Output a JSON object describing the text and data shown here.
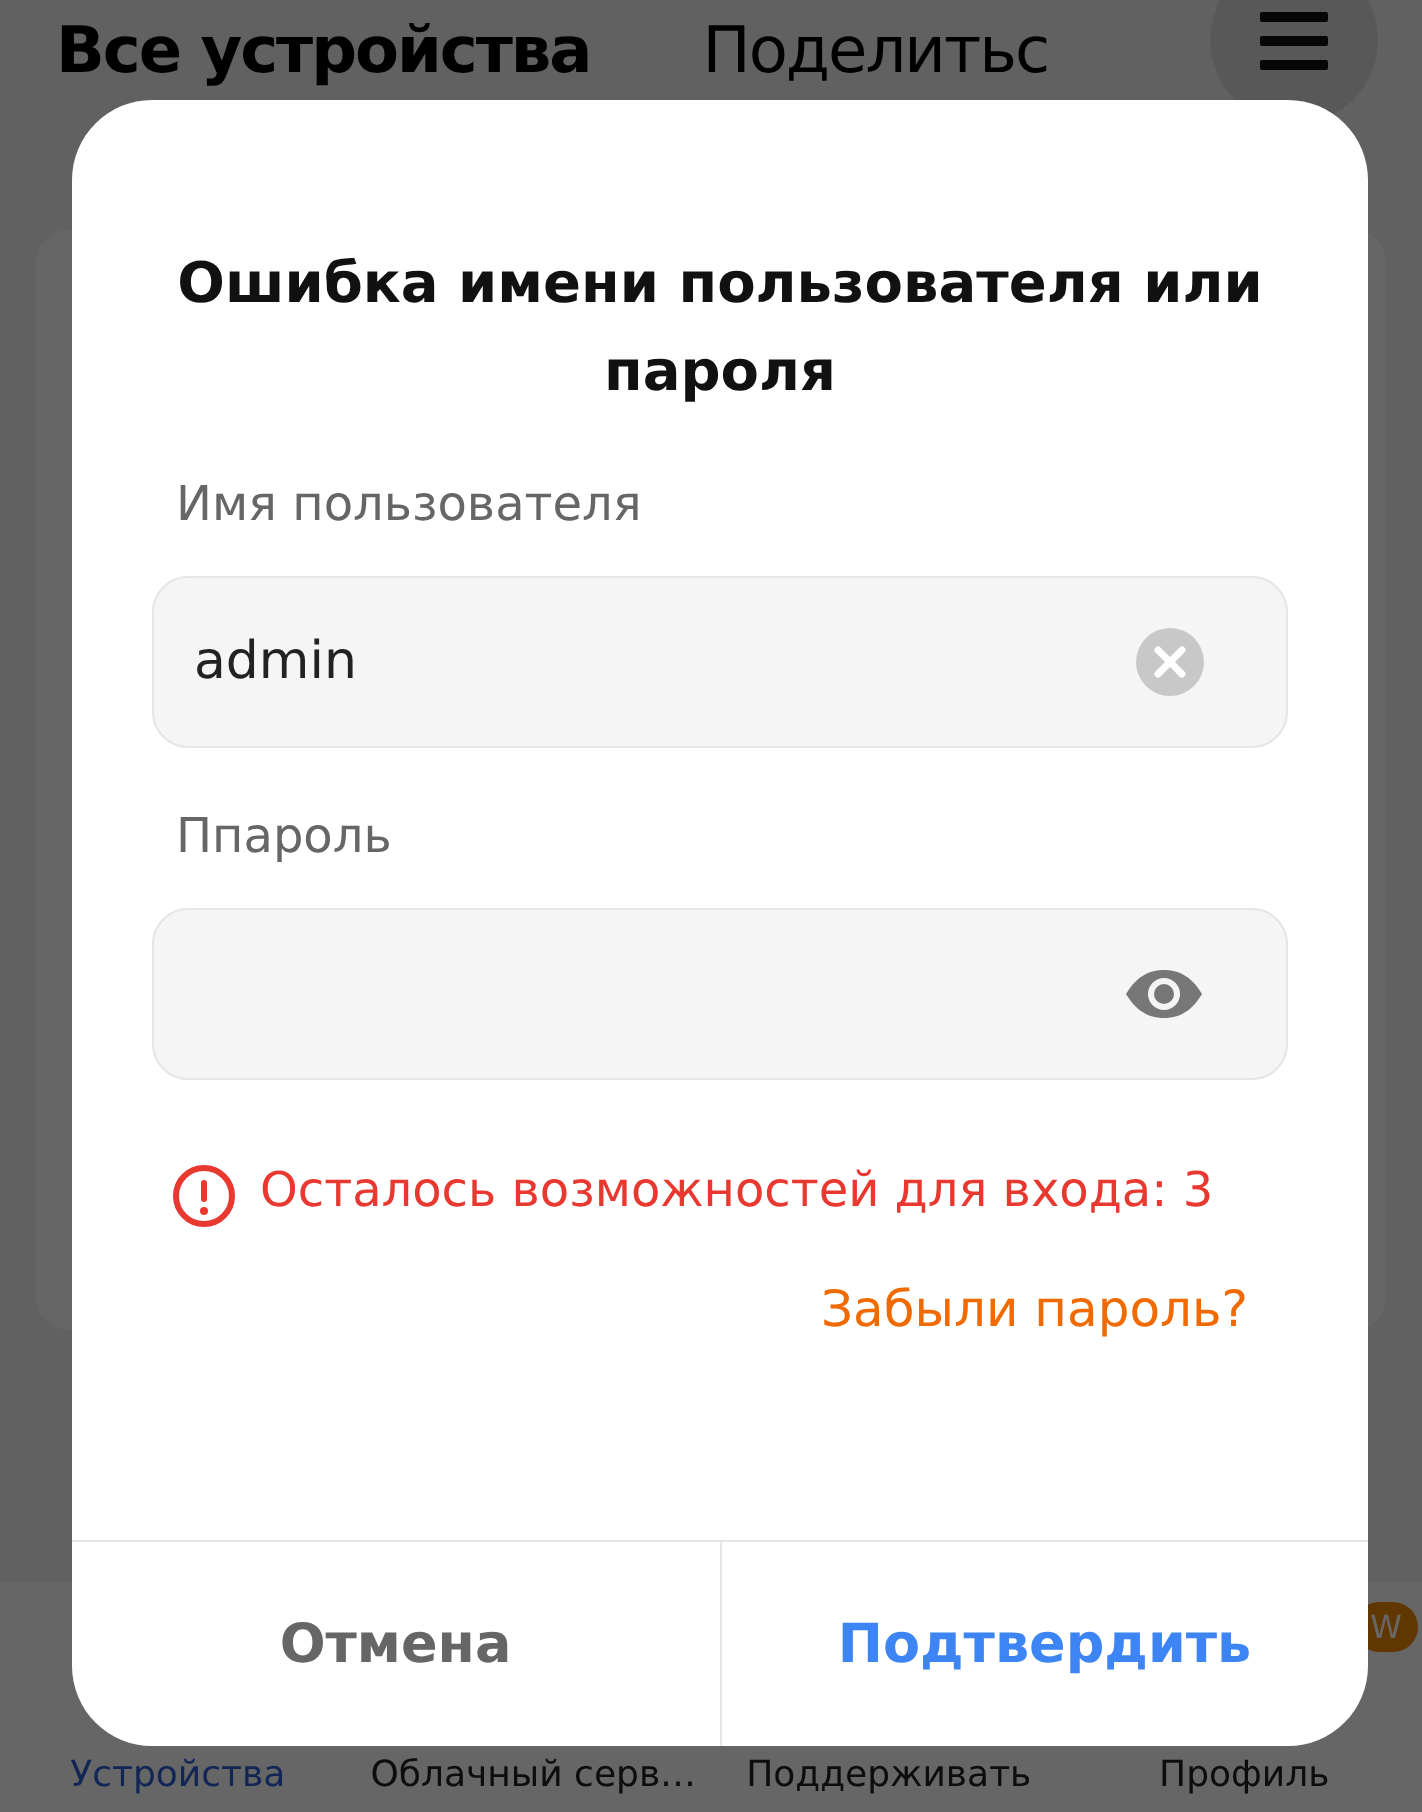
{
  "header": {
    "title": "Все устройства",
    "share": "Поделитьс"
  },
  "dialog": {
    "title": "Ошибка имени пользователя или пароля",
    "fields": [
      {
        "kind": "text",
        "label": "Имя пользователя",
        "value": "admin"
      },
      {
        "kind": "password",
        "label": "Ппароль"
      }
    ],
    "error": "Осталось возможностей для входа: 3",
    "forgot": "Забыли пароль?",
    "buttons": [
      {
        "kind": "cancel",
        "label": "Отмена"
      },
      {
        "kind": "confirm",
        "label": "Подтвердить"
      }
    ]
  },
  "nav": [
    {
      "label": "Устройства",
      "selected": true
    },
    {
      "label": "Облачный серв…",
      "selected": false
    },
    {
      "label": "Поддерживать",
      "selected": false
    },
    {
      "label": "Профиль",
      "selected": false,
      "badge": "W"
    }
  ]
}
